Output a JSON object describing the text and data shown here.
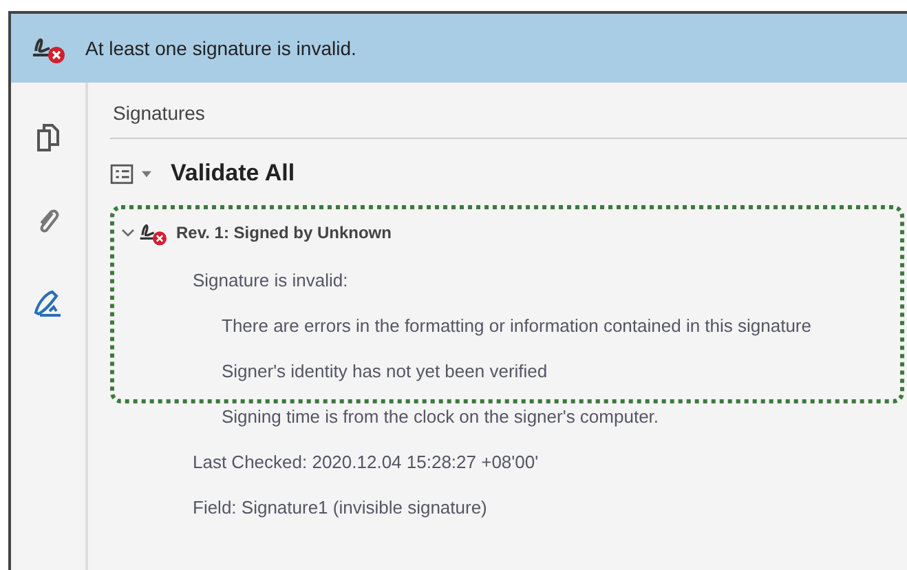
{
  "banner": {
    "valid": false,
    "message": "At least one signature is invalid."
  },
  "sidebar": {
    "items": [
      {
        "kind": "pages",
        "selected": false
      },
      {
        "kind": "attachments",
        "selected": false
      },
      {
        "kind": "signatures",
        "selected": true
      }
    ]
  },
  "panel": {
    "title": "Signatures",
    "toolbar": {
      "action": "Validate All"
    }
  },
  "signatures": [
    {
      "title": "Rev. 1: Signed by Unknown",
      "valid": false,
      "expanded": true,
      "focused": true,
      "children": [
        {
          "text": "Signature is invalid:",
          "children": [
            {
              "text": "There are errors in the formatting or information contained in this signature"
            },
            {
              "text": "Signer's identity has not yet been verified"
            },
            {
              "text": "Signing time is from the clock on the signer's computer."
            }
          ]
        },
        {
          "text": "Last Checked: 2020.12.04 15:28:27 +08'00'"
        },
        {
          "text": "Field: Signature1 (invisible signature)"
        }
      ]
    }
  ]
}
